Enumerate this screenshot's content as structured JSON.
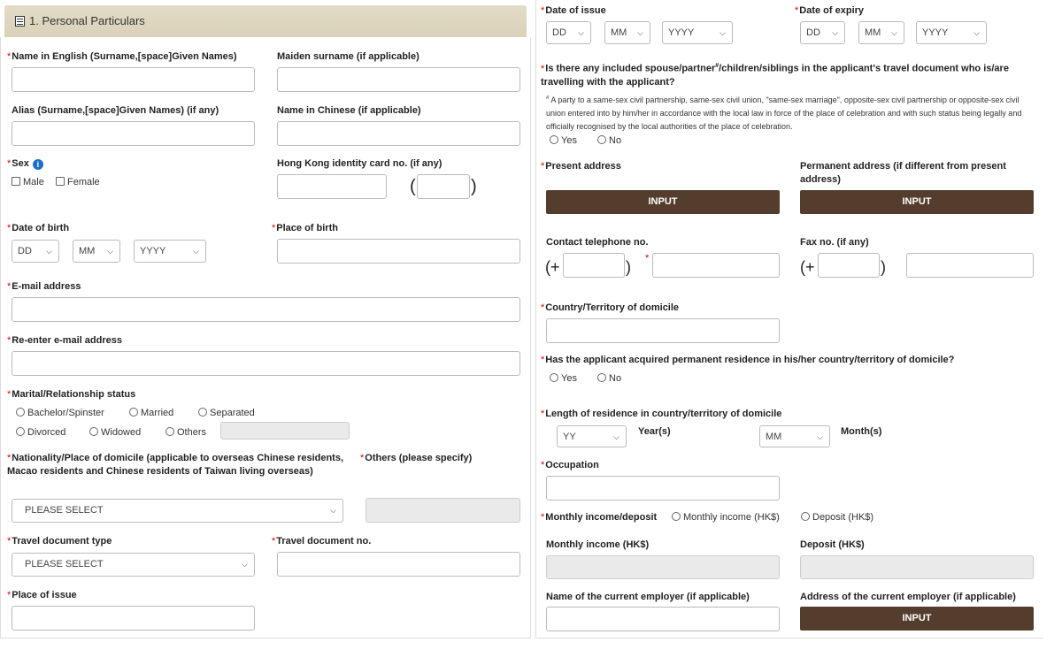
{
  "section": {
    "title": "1. Personal Particulars",
    "icon": "list-icon"
  },
  "left": {
    "name_english": "Name in English (Surname,[space]Given Names)",
    "maiden_surname": "Maiden surname (if applicable)",
    "alias": "Alias (Surname,[space]Given Names) (if any)",
    "name_chinese": "Name in Chinese (if applicable)",
    "sex": {
      "label": "Sex",
      "info_icon": "i",
      "male": "Male",
      "female": "Female"
    },
    "hkid": "Hong Kong identity card no. (if any)",
    "paren_open": "(",
    "paren_close": ")",
    "dob": {
      "label": "Date of birth",
      "dd": "DD",
      "mm": "MM",
      "yyyy": "YYYY"
    },
    "place_of_birth": "Place of birth",
    "email": "E-mail address",
    "reenter_email": "Re-enter e-mail address",
    "marital": {
      "label": "Marital/Relationship status",
      "options": [
        "Bachelor/Spinster",
        "Married",
        "Separated",
        "Divorced",
        "Widowed",
        "Others"
      ]
    },
    "nationality": {
      "label": "Nationality/Place of domicile (applicable to overseas Chinese residents, Macao residents and Chinese residents of Taiwan living overseas)",
      "value": "PLEASE SELECT"
    },
    "others_specify": "Others (please specify)",
    "travel_doc_type": {
      "label": "Travel document type",
      "value": "PLEASE SELECT"
    },
    "travel_doc_no": "Travel document no.",
    "place_of_issue": "Place of issue"
  },
  "right": {
    "date_of_issue": {
      "label": "Date of issue",
      "dd": "DD",
      "mm": "MM",
      "yyyy": "YYYY"
    },
    "date_of_expiry": {
      "label": "Date of expiry",
      "dd": "DD",
      "mm": "MM",
      "yyyy": "YYYY"
    },
    "spouse_q": {
      "label_a": "Is there any included spouse/partner",
      "sup": "#",
      "label_b": "/children/siblings in the applicant's travel document who is/are travelling with the applicant?",
      "note_sup": "#",
      "note": " A party to a same-sex civil partnership, same-sex civil union, \"same-sex marriage\", opposite-sex civil partnership or opposite-sex civil union entered into by him/her in accordance with the local law in force of the place of celebration and with such status being legally and officially recognised by the local authorities of the place of celebration.",
      "yes": "Yes",
      "no": "No"
    },
    "present_address": "Present address",
    "permanent_address": "Permanent address (if different from present address)",
    "input_btn": "INPUT",
    "contact_tel": "Contact telephone no.",
    "fax": "Fax no. (if any)",
    "paren_open": "(+",
    "paren_close": ")",
    "domicile_country": "Country/Territory of domicile",
    "perm_res_q": {
      "label": "Has the applicant acquired permanent residence in his/her country/territory of domicile?",
      "yes": "Yes",
      "no": "No"
    },
    "length_res": {
      "label": "Length of residence in country/territory of domicile",
      "yy": "YY",
      "years": "Year(s)",
      "mm": "MM",
      "months": "Month(s)"
    },
    "occupation": "Occupation",
    "income": {
      "label": "Monthly income/deposit",
      "opt1": "Monthly income (HK$)",
      "opt2": "Deposit (HK$)"
    },
    "monthly_income": "Monthly income (HK$)",
    "deposit": "Deposit (HK$)",
    "employer_name": "Name of the current employer (if applicable)",
    "employer_address": "Address of the current employer (if applicable)"
  }
}
